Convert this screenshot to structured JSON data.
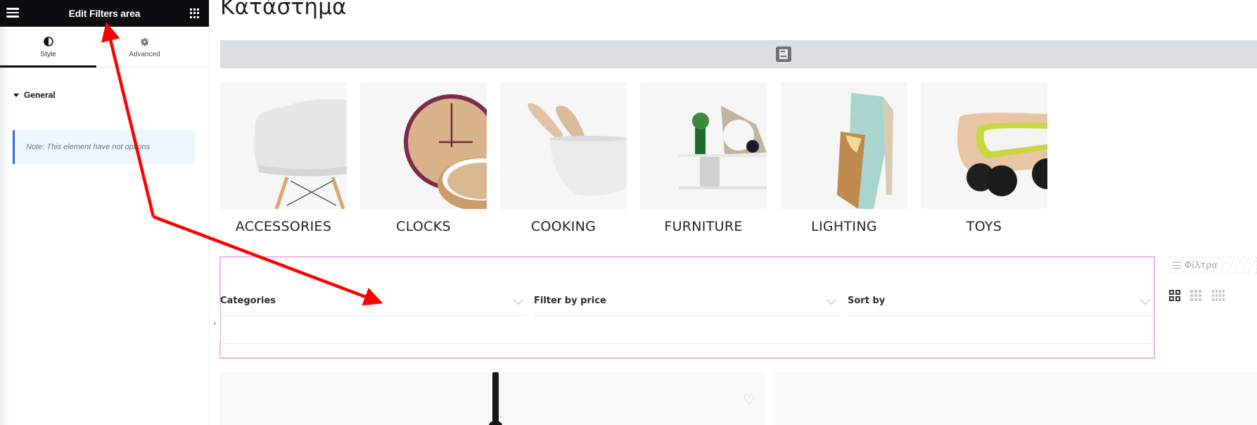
{
  "sidebar": {
    "title": "Edit Filters area",
    "menu_icon": "hamburger-icon",
    "apps_icon": "grid-icon",
    "tabs": [
      {
        "label": "Style",
        "icon": "contrast-icon",
        "active": true
      },
      {
        "label": "Advanced",
        "icon": "gear-icon",
        "active": false
      }
    ],
    "section": {
      "label": "General",
      "expanded": true
    },
    "note": "Note: This element have not options",
    "collapse_icon": "‹"
  },
  "main": {
    "page_title": "Κατάστημα",
    "placeholder_icon": "image-placeholder-icon",
    "categories": [
      {
        "name": "ACCESSORIES",
        "image": "white chair"
      },
      {
        "name": "CLOCKS",
        "image": "wooden clock"
      },
      {
        "name": "COOKING",
        "image": "bowl with spoons"
      },
      {
        "name": "FURNITURE",
        "image": "wall shelf"
      },
      {
        "name": "LIGHTING",
        "image": "table lamp"
      },
      {
        "name": "TOYS",
        "image": "wooden toy car"
      }
    ],
    "filters": [
      {
        "label": "Categories"
      },
      {
        "label": "Filter by price"
      },
      {
        "label": "Sort by"
      }
    ],
    "filters_button": "Φίλτρα",
    "view_modes": [
      {
        "columns": 2,
        "active": true
      },
      {
        "columns": 3,
        "active": false
      },
      {
        "columns": 4,
        "active": false
      }
    ],
    "wishlist_icon": "♡"
  },
  "colors": {
    "sidebar_header_bg": "#0c0d0e",
    "note_accent": "#2b6de0",
    "note_bg": "#eef5fd",
    "filters_area_border": "#ecb7f0",
    "placeholder_bg": "#dcdfe2",
    "annotation_arrow": "#ff0000"
  }
}
